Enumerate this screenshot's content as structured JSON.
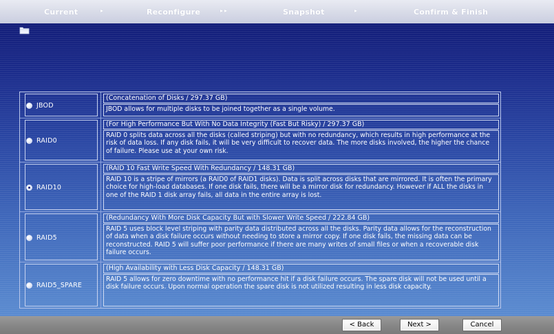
{
  "wizard": {
    "steps": [
      "Current",
      "Reconfigure",
      "Snapshot",
      "Confirm & Finish"
    ]
  },
  "options": [
    {
      "name": "JBOD",
      "selected": false,
      "headline": "(Concatenation of Disks / 297.37 GB)",
      "description": "JBOD allows for multiple disks to be joined together as a single volume."
    },
    {
      "name": "RAID0",
      "selected": false,
      "headline": "(For High Performance But With No Data Integrity (Fast But Risky) / 297.37 GB)",
      "description": "RAID 0 splits data across all the disks (called striping) but with no redundancy, which results in high performance at the risk of data loss. If any disk fails, it will be very difficult to recover data. The more disks involved, the higher the chance of failure. Please use at your own risk."
    },
    {
      "name": "RAID10",
      "selected": true,
      "headline": "(RAID 10 Fast Write Speed With Redundancy / 148.31 GB)",
      "description": "RAID 10 is a stripe of mirrors (a RAID0 of RAID1 disks). Data is split across disks that are mirrored. It is often the primary choice for high-load databases. If one disk fails, there will be a mirror disk for redundancy. However if ALL the disks in one of the RAID 1 disk array fails, all data in the entire array is lost."
    },
    {
      "name": "RAID5",
      "selected": false,
      "headline": "(Redundancy With More Disk Capacity But with Slower Write Speed / 222.84 GB)",
      "description": "RAID 5 uses block level striping with parity data distributed across all the disks. Parity data allows for the reconstruction of data when a disk failure occurs without needing to store a mirror copy. If one disk fails, the missing data can be reconstructed. RAID 5 will suffer poor performance if there are many writes of small files or when a recoverable disk failure occurs."
    },
    {
      "name": "RAID5_SPARE",
      "selected": false,
      "headline": "(High Availability with Less Disk Capacity / 148.31 GB)",
      "description": "RAID 5 allows for zero downtime with no performance hit if a disk failure occurs. The spare disk will not be used until a disk failure occurs. Upon normal operation the spare disk is not utilized resulting in less disk capacity."
    }
  ],
  "buttons": {
    "back": "< Back",
    "next": "Next >",
    "cancel": "Cancel"
  },
  "icons": {
    "folder": "folder-icon",
    "step_arrow": "chevron-right-icon"
  }
}
